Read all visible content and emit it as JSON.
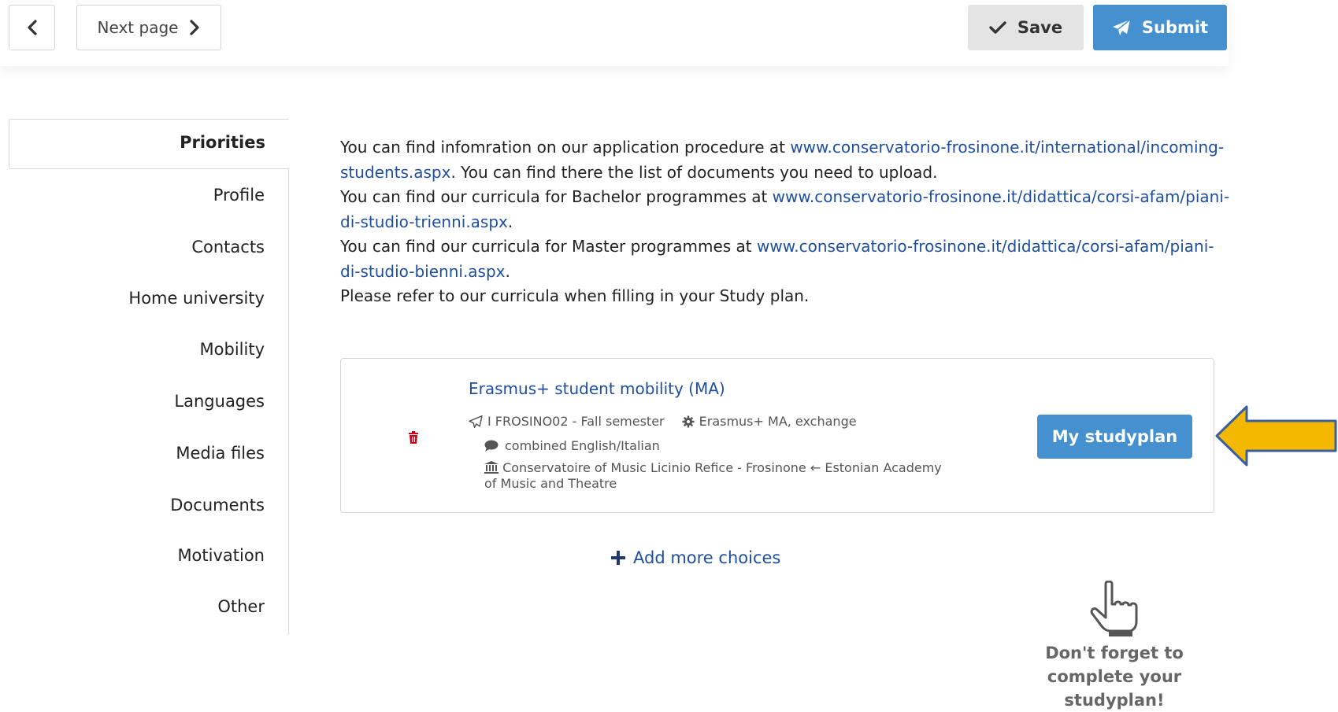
{
  "toolbar": {
    "back_icon": "chevron-left-icon",
    "next_label": "Next page",
    "next_icon": "chevron-right-icon",
    "save_label": "Save",
    "save_icon": "check-icon",
    "submit_label": "Submit",
    "submit_icon": "paper-plane-icon",
    "submit_color": "#4590cf",
    "save_color": "#e4e4e4"
  },
  "sidebar": {
    "items": [
      {
        "label": "Priorities",
        "active": true
      },
      {
        "label": "Profile"
      },
      {
        "label": "Contacts"
      },
      {
        "label": "Home university"
      },
      {
        "label": "Mobility"
      },
      {
        "label": "Languages"
      },
      {
        "label": "Media files"
      },
      {
        "label": "Documents"
      },
      {
        "label": "Motivation"
      },
      {
        "label": "Other"
      }
    ]
  },
  "info": {
    "p1_text": "You can find infomration on our application procedure at ",
    "p1_link": "www.conservatorio-frosinone.it/international/incoming-students.aspx",
    "p1_tail": ". You can find there the list of documents you need to upload.",
    "p2_text": "You can find our curricula for Bachelor programmes at ",
    "p2_link": "www.conservatorio-frosinone.it/didattica/corsi-afam/piani-di-studio-trienni.aspx",
    "p2_tail": ".",
    "p3_text": "You can find our curricula for Master programmes at ",
    "p3_link": "www.conservatorio-frosinone.it/didattica/corsi-afam/piani-di-studio-bienni.aspx",
    "p3_tail": ".",
    "p4_text": "Please refer to our curricula when filling in your Study plan."
  },
  "choice": {
    "title": "Erasmus+ student mobility (MA)",
    "institution_code": "I FROSINO02 - Fall semester",
    "programme": "Erasmus+ MA, exchange",
    "language": "combined English/Italian",
    "host": "Conservatoire of Music Licinio Refice - Frosinone",
    "home": "Estonian Academy of Music and Theatre",
    "studyplan_label": "My studyplan",
    "delete_icon": "trash-icon",
    "link_color": "#1e4f9e"
  },
  "add_more_label": "Add more choices",
  "reminder": "Don't forget to complete your studyplan!",
  "accent": {
    "arrow_color": "#f5b800"
  }
}
